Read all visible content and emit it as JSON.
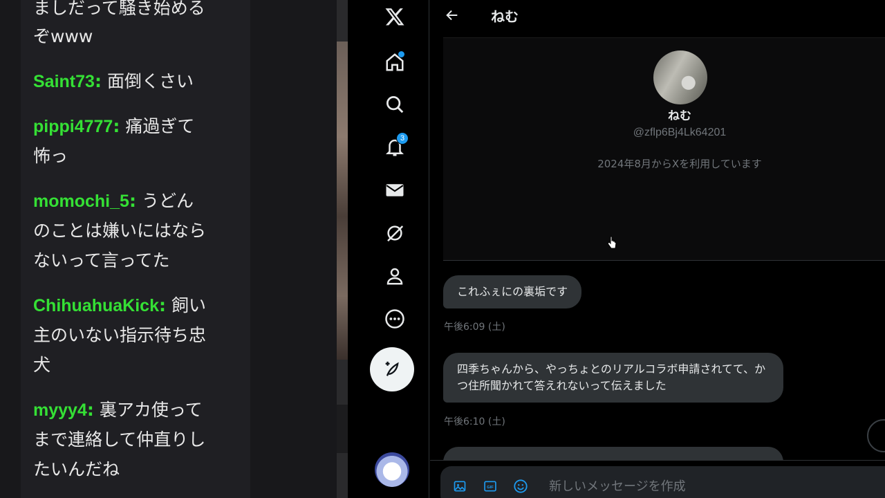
{
  "chat": {
    "messages": [
      {
        "user": "",
        "text": "ましだって騒き始める"
      },
      {
        "user": "",
        "text": "ぞwww"
      },
      {
        "user": "Saint73",
        "text": "面倒くさい"
      },
      {
        "user": "pippi4777",
        "text": "痛過ぎて"
      },
      {
        "user": "",
        "text": "怖っ"
      },
      {
        "user": "momochi_5",
        "text": "うどん"
      },
      {
        "user": "",
        "text": "のことは嫌いにはなら"
      },
      {
        "user": "",
        "text": "ないって言ってた"
      },
      {
        "user": "ChihuahuaKick",
        "text": "飼い"
      },
      {
        "user": "",
        "text": "主のいない指示待ち忠"
      },
      {
        "user": "",
        "text": "犬"
      },
      {
        "user": "myyy4",
        "text": "裏アカ使って"
      },
      {
        "user": "",
        "text": "まで連絡して仲直りし"
      },
      {
        "user": "",
        "text": "たいんだね"
      }
    ],
    "colon": ":",
    "username_color": "#35e035"
  },
  "nav": {
    "logo": "x-logo-icon",
    "items": [
      "home-icon",
      "search-icon",
      "bell-icon",
      "mail-icon",
      "grok-icon",
      "profile-icon",
      "more-icon"
    ],
    "notification_count": "3",
    "accent": "#1d9bf0"
  },
  "conversation": {
    "title": "ねむ",
    "profile": {
      "name": "ねむ",
      "handle": "@zflp6Bj4Lk64201",
      "joined": "2024年8月からXを利用しています"
    },
    "messages": [
      {
        "text": "これふぇにの裏垢です",
        "time": "午後6:09 (土)"
      },
      {
        "text": "四季ちゃんから、やっちょとのリアルコラボ申請されてて、かつ住所聞かれて答えれないって伝えました",
        "time": "午後6:10 (土)"
      }
    ],
    "composer_placeholder": "新しいメッセージを作成"
  }
}
